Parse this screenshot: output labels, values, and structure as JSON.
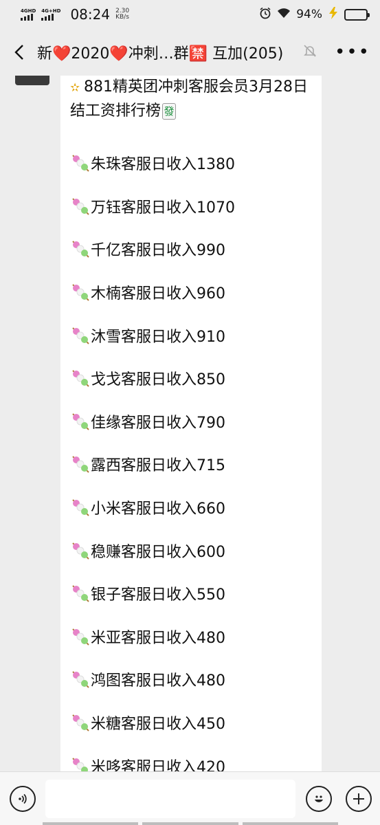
{
  "status_bar": {
    "network_1": "4GHD",
    "network_2": "4G+HD",
    "time": "08:24",
    "speed_value": "2.30",
    "speed_unit": "KB/s",
    "battery": "94%",
    "battery_level": 0.94
  },
  "nav": {
    "title": "新❤️2020❤️冲刺…群🈲 互加(205)",
    "back_icon": "chevron-left-icon",
    "mute_icon": "bell-off-icon",
    "more_icon": "more-icon"
  },
  "message": {
    "headline_icon": "dizzy-star-icon",
    "headline": "881精英团冲刺客服会员3月28日结工资排行榜",
    "headline_tile": "發",
    "row_icon": "dango-icon",
    "rows": [
      "朱珠客服日收入1380",
      "万钰客服日收入1070",
      "千亿客服日收入990",
      "木楠客服日收入960",
      "沐雪客服日收入910",
      "戈戈客服日收入850",
      "佳缘客服日收入790",
      "露西客服日收入715",
      "小米客服日收入660",
      "稳赚客服日收入600",
      "银子客服日收入550",
      "米亚客服日收入480",
      "鸿图客服日收入480",
      "米糖客服日收入450",
      "米哆客服日收入420"
    ]
  },
  "input_bar": {
    "voice_icon": "voice-icon",
    "text_value": "",
    "emoji_icon": "emoji-icon",
    "plus_icon": "plus-icon"
  }
}
